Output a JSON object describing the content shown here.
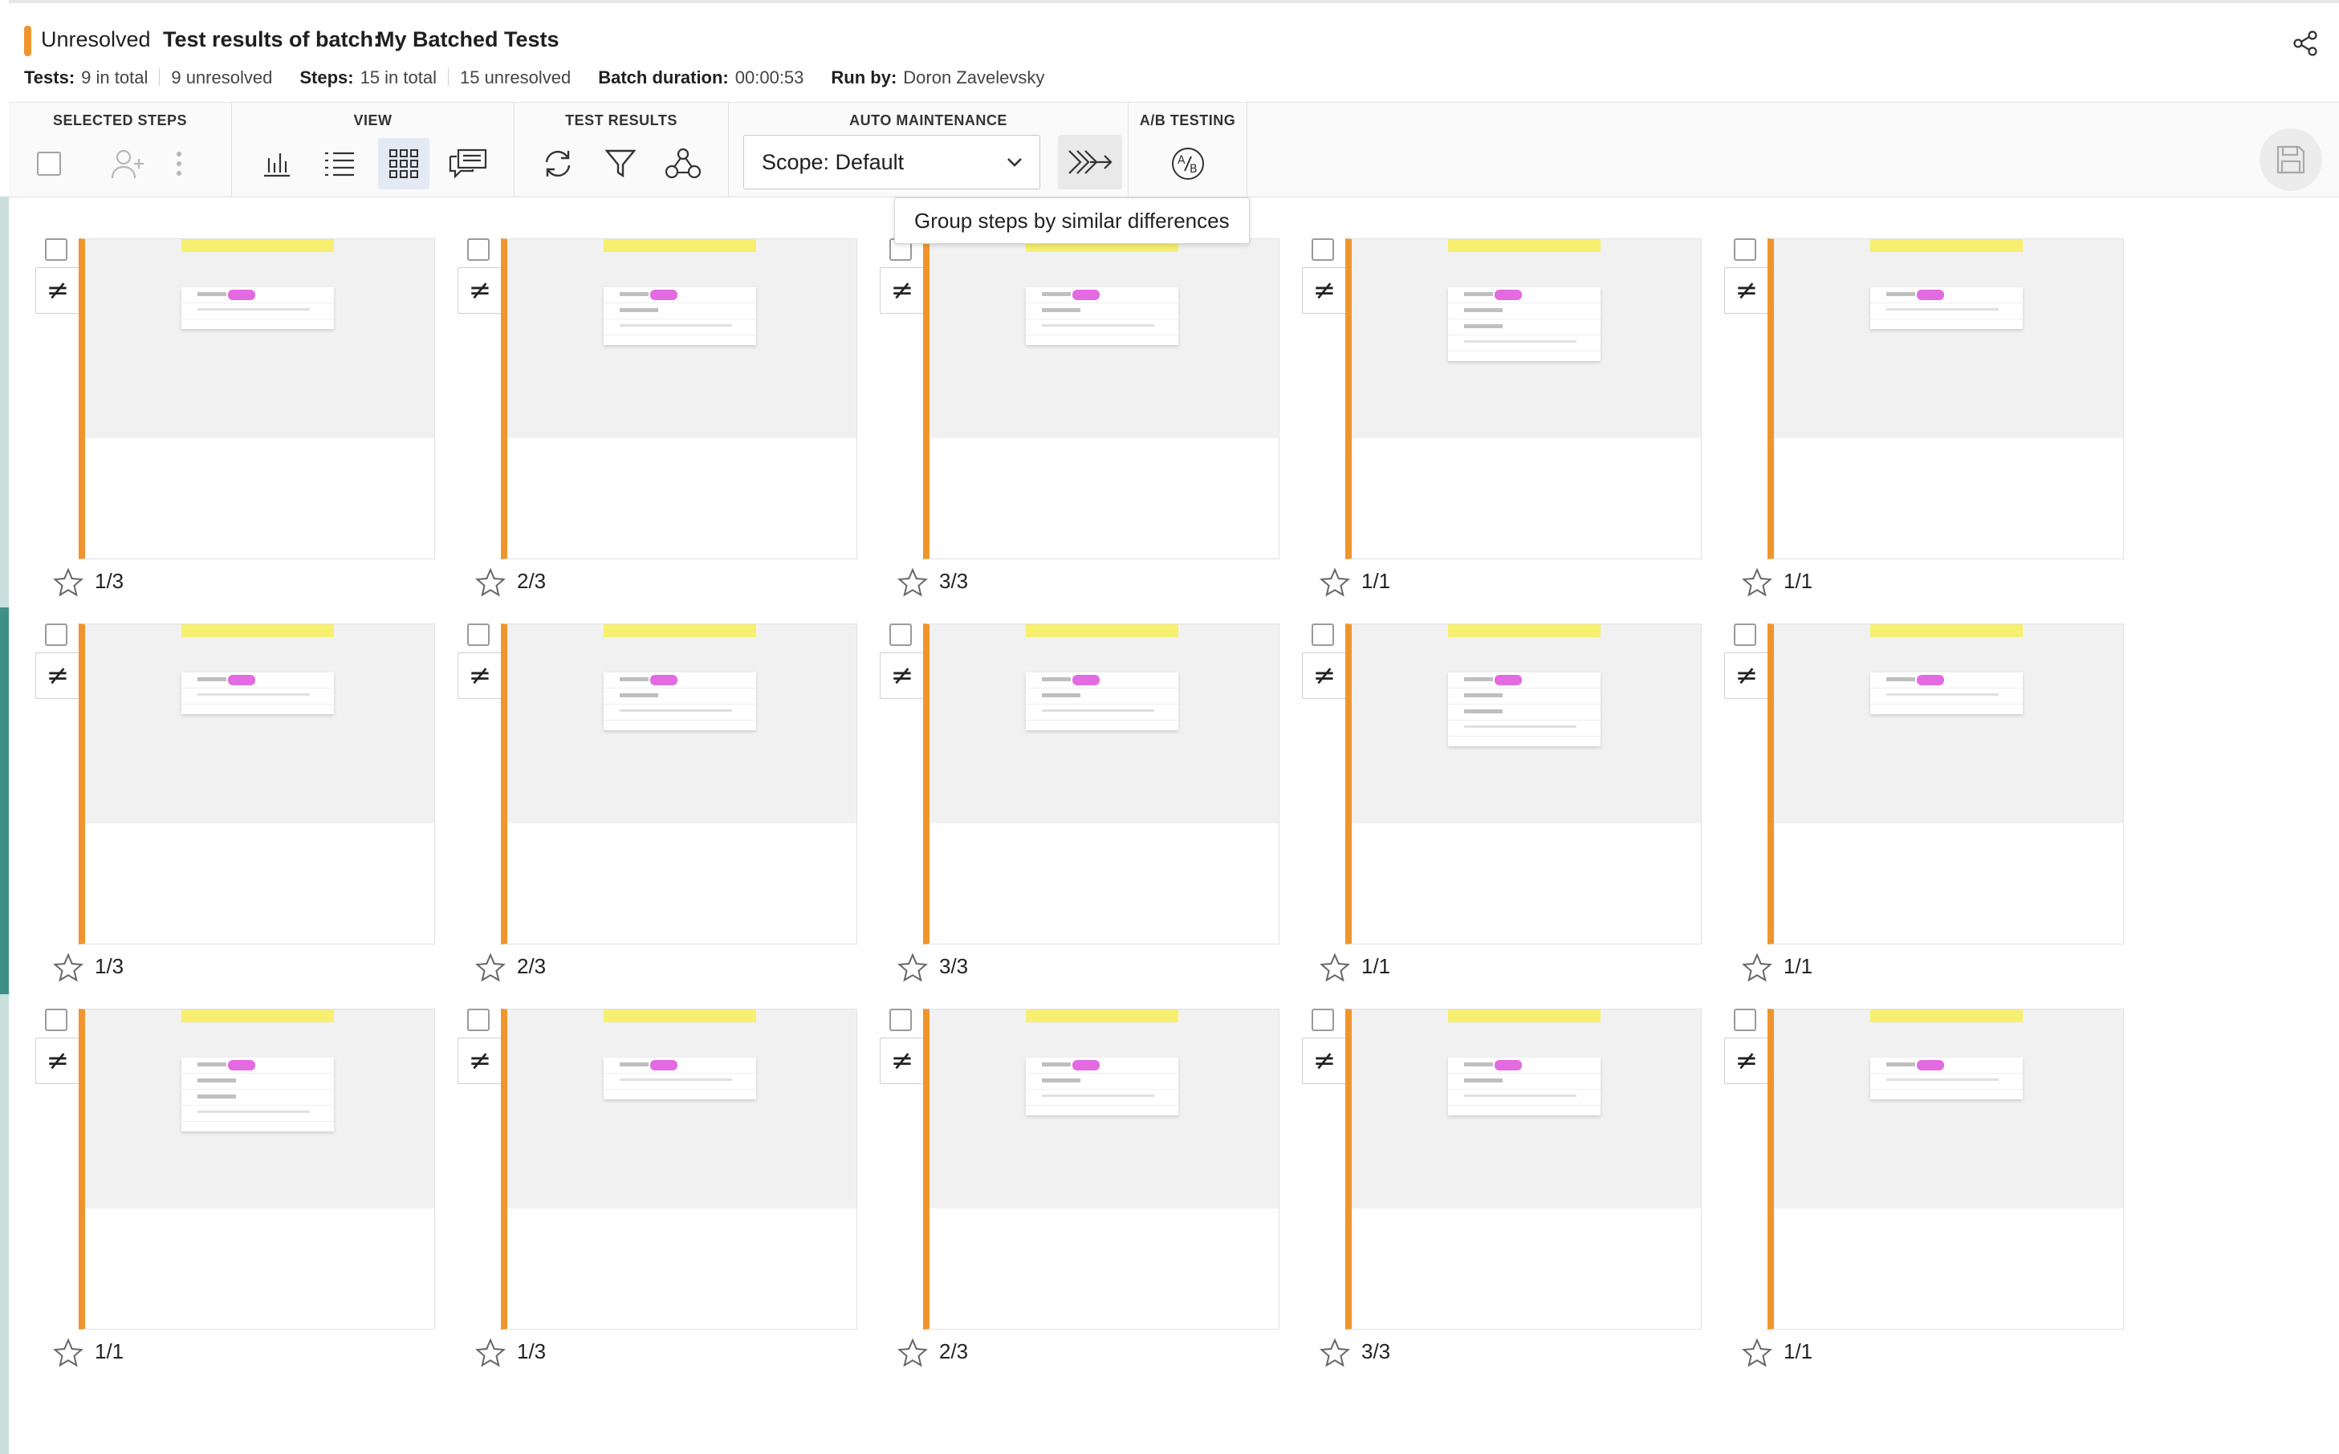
{
  "header": {
    "status": "Unresolved",
    "title_prefix": "Test results of batch:",
    "title_name": "My Batched Tests",
    "stats": {
      "tests_label": "Tests:",
      "tests_total": "9 in total",
      "tests_unresolved": "9 unresolved",
      "steps_label": "Steps:",
      "steps_total": "15 in total",
      "steps_unresolved": "15 unresolved",
      "duration_label": "Batch duration:",
      "duration": "00:00:53",
      "runby_label": "Run by:",
      "runby": "Doron Zavelevsky"
    }
  },
  "toolbar": {
    "selected_steps": "SELECTED STEPS",
    "view": "VIEW",
    "test_results": "TEST RESULTS",
    "auto_maintenance": "AUTO MAINTENANCE",
    "ab_testing": "A/B TESTING",
    "scope_value": "Scope: Default",
    "tooltip": "Group steps by similar differences"
  },
  "colors": {
    "accent_orange": "#f0952c",
    "sidebar_teal": "#3e8f86",
    "active_view_bg": "#e3eaf6"
  },
  "icons": {
    "share": "share-icon",
    "assign": "assign-user-icon",
    "more": "more-vertical-icon",
    "bar_chart": "bar-chart-icon",
    "list": "list-view-icon",
    "grid": "grid-view-icon",
    "comments": "comments-icon",
    "refresh": "refresh-icon",
    "filter": "filter-icon",
    "cluster": "cluster-icon",
    "group": "group-similar-icon",
    "ab": "ab-testing-icon",
    "save": "save-icon",
    "diff": "diff-icon",
    "star": "star-icon"
  },
  "steps": [
    {
      "count": "1/3",
      "diff": "≠",
      "rows": 2
    },
    {
      "count": "2/3",
      "diff": "≠",
      "rows": 3
    },
    {
      "count": "3/3",
      "diff": "≠",
      "rows": 3
    },
    {
      "count": "1/1",
      "diff": "≠",
      "rows": 4
    },
    {
      "count": "1/1",
      "diff": "≠",
      "rows": 2
    },
    {
      "count": "1/3",
      "diff": "≠",
      "rows": 2
    },
    {
      "count": "2/3",
      "diff": "≠",
      "rows": 3
    },
    {
      "count": "3/3",
      "diff": "≠",
      "rows": 3
    },
    {
      "count": "1/1",
      "diff": "≠",
      "rows": 4
    },
    {
      "count": "1/1",
      "diff": "≠",
      "rows": 2
    },
    {
      "count": "1/1",
      "diff": "≠",
      "rows": 4
    },
    {
      "count": "1/3",
      "diff": "≠",
      "rows": 2
    },
    {
      "count": "2/3",
      "diff": "≠",
      "rows": 3
    },
    {
      "count": "3/3",
      "diff": "≠",
      "rows": 3
    },
    {
      "count": "1/1",
      "diff": "≠",
      "rows": 2
    }
  ]
}
